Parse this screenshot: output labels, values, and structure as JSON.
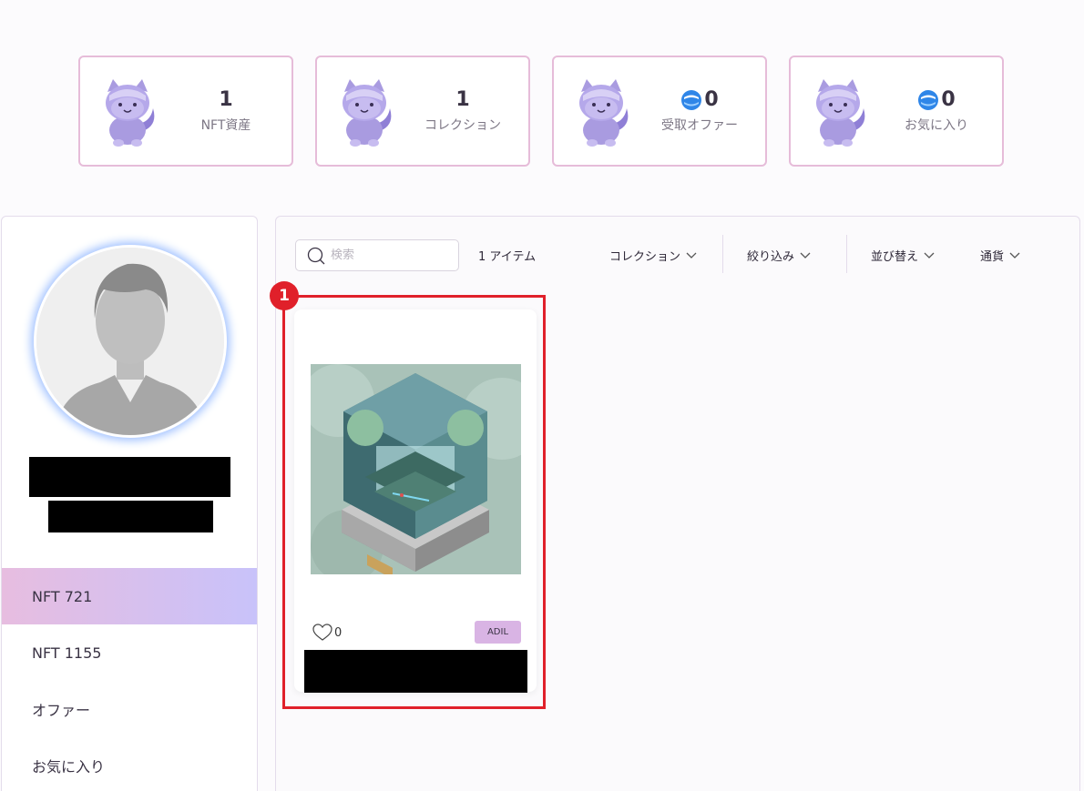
{
  "stats": [
    {
      "value": "1",
      "label": "NFT資産",
      "has_coin": false
    },
    {
      "value": "1",
      "label": "コレクション",
      "has_coin": false
    },
    {
      "value": "0",
      "label": "受取オファー",
      "has_coin": true
    },
    {
      "value": "0",
      "label": "お気に入り",
      "has_coin": true
    }
  ],
  "sidebar": {
    "items": [
      {
        "label": "NFT 721",
        "active": true
      },
      {
        "label": "NFT 1155"
      },
      {
        "label": "オファー"
      },
      {
        "label": "お気に入り"
      }
    ]
  },
  "toolbar": {
    "search_placeholder": "検索",
    "item_count": "1 アイテム",
    "filters": [
      "コレクション",
      "絞り込み",
      "並び替え",
      "通貨"
    ]
  },
  "nft": {
    "likes": "0",
    "tag": "ADIL",
    "annotation_number": "1"
  },
  "colors": {
    "card_border": "#e6bcd9",
    "highlight": "#e0202a",
    "active_gradient_start": "#e7bde0",
    "active_gradient_end": "#c8c2fa",
    "mascot": "#a99be0",
    "coin": "#2f86e8"
  }
}
